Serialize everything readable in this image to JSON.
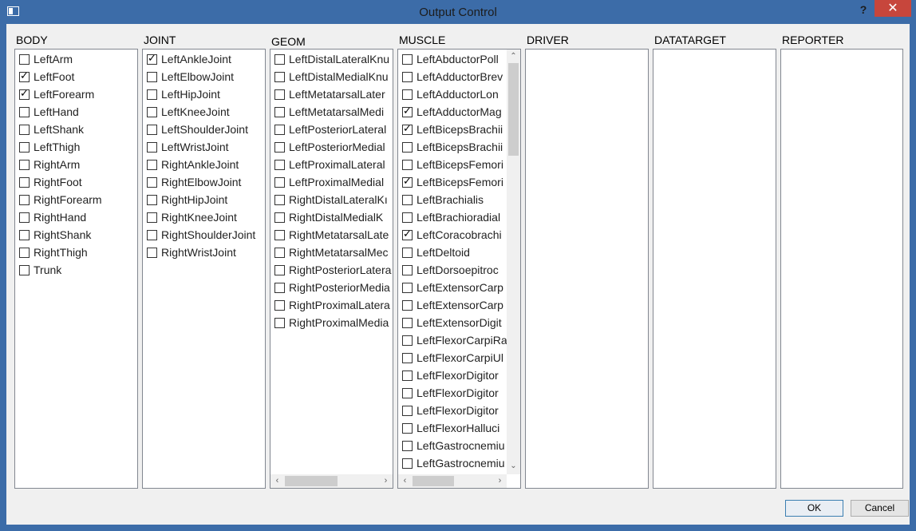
{
  "window": {
    "title": "Output Control",
    "help_label": "?",
    "close_label": "✕"
  },
  "columns": [
    {
      "label": "BODY",
      "items": [
        {
          "label": "LeftArm",
          "checked": false
        },
        {
          "label": "LeftFoot",
          "checked": true
        },
        {
          "label": "LeftForearm",
          "checked": true
        },
        {
          "label": "LeftHand",
          "checked": false
        },
        {
          "label": "LeftShank",
          "checked": false
        },
        {
          "label": "LeftThigh",
          "checked": false
        },
        {
          "label": "RightArm",
          "checked": false
        },
        {
          "label": "RightFoot",
          "checked": false
        },
        {
          "label": "RightForearm",
          "checked": false
        },
        {
          "label": "RightHand",
          "checked": false
        },
        {
          "label": "RightShank",
          "checked": false
        },
        {
          "label": "RightThigh",
          "checked": false
        },
        {
          "label": "Trunk",
          "checked": false
        }
      ]
    },
    {
      "label": "JOINT",
      "items": [
        {
          "label": "LeftAnkleJoint",
          "checked": true
        },
        {
          "label": "LeftElbowJoint",
          "checked": false
        },
        {
          "label": "LeftHipJoint",
          "checked": false
        },
        {
          "label": "LeftKneeJoint",
          "checked": false
        },
        {
          "label": "LeftShoulderJoint",
          "checked": false
        },
        {
          "label": "LeftWristJoint",
          "checked": false
        },
        {
          "label": "RightAnkleJoint",
          "checked": false
        },
        {
          "label": "RightElbowJoint",
          "checked": false
        },
        {
          "label": "RightHipJoint",
          "checked": false
        },
        {
          "label": "RightKneeJoint",
          "checked": false
        },
        {
          "label": "RightShoulderJoint",
          "checked": false
        },
        {
          "label": "RightWristJoint",
          "checked": false
        }
      ]
    },
    {
      "label": "GEOM",
      "items": [
        {
          "label": "LeftDistalLateralKnu",
          "checked": false
        },
        {
          "label": "LeftDistalMedialKnu",
          "checked": false
        },
        {
          "label": "LeftMetatarsalLater",
          "checked": false
        },
        {
          "label": "LeftMetatarsalMedi",
          "checked": false
        },
        {
          "label": "LeftPosteriorLateral",
          "checked": false
        },
        {
          "label": "LeftPosteriorMedial",
          "checked": false
        },
        {
          "label": "LeftProximalLateral",
          "checked": false
        },
        {
          "label": "LeftProximalMedial",
          "checked": false
        },
        {
          "label": "RightDistalLateralKı",
          "checked": false
        },
        {
          "label": "RightDistalMedialK",
          "checked": false
        },
        {
          "label": "RightMetatarsalLate",
          "checked": false
        },
        {
          "label": "RightMetatarsalMec",
          "checked": false
        },
        {
          "label": "RightPosteriorLatera",
          "checked": false
        },
        {
          "label": "RightPosteriorMedia",
          "checked": false
        },
        {
          "label": "RightProximalLatera",
          "checked": false
        },
        {
          "label": "RightProximalMedia",
          "checked": false
        }
      ]
    },
    {
      "label": "MUSCLE",
      "items": [
        {
          "label": "LeftAbductorPoll",
          "checked": false
        },
        {
          "label": "LeftAdductorBrev",
          "checked": false
        },
        {
          "label": "LeftAdductorLon",
          "checked": false
        },
        {
          "label": "LeftAdductorMag",
          "checked": true
        },
        {
          "label": "LeftBicepsBrachii",
          "checked": true
        },
        {
          "label": "LeftBicepsBrachii",
          "checked": false
        },
        {
          "label": "LeftBicepsFemori",
          "checked": false
        },
        {
          "label": "LeftBicepsFemori",
          "checked": true
        },
        {
          "label": "LeftBrachialis",
          "checked": false
        },
        {
          "label": "LeftBrachioradial",
          "checked": false
        },
        {
          "label": "LeftCoracobrachi",
          "checked": true
        },
        {
          "label": "LeftDeltoid",
          "checked": false
        },
        {
          "label": "LeftDorsoepitroc",
          "checked": false
        },
        {
          "label": "LeftExtensorCarp",
          "checked": false
        },
        {
          "label": "LeftExtensorCarp",
          "checked": false
        },
        {
          "label": "LeftExtensorDigit",
          "checked": false
        },
        {
          "label": "LeftFlexorCarpiRa",
          "checked": false
        },
        {
          "label": "LeftFlexorCarpiUl",
          "checked": false
        },
        {
          "label": "LeftFlexorDigitor",
          "checked": false
        },
        {
          "label": "LeftFlexorDigitor",
          "checked": false
        },
        {
          "label": "LeftFlexorDigitor",
          "checked": false
        },
        {
          "label": "LeftFlexorHalluci",
          "checked": false
        },
        {
          "label": "LeftGastrocnemiu",
          "checked": false
        },
        {
          "label": "LeftGastrocnemiu",
          "checked": false
        }
      ]
    },
    {
      "label": "DRIVER",
      "items": []
    },
    {
      "label": "DATATARGET",
      "items": []
    },
    {
      "label": "REPORTER",
      "items": []
    }
  ],
  "buttons": {
    "ok": "OK",
    "cancel": "Cancel"
  }
}
